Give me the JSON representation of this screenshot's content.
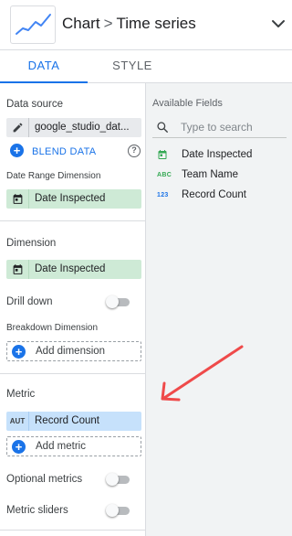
{
  "header": {
    "breadcrumb_parent": "Chart",
    "breadcrumb_separator": ">",
    "breadcrumb_current": "Time series"
  },
  "tabs": [
    {
      "label": "DATA",
      "active": true
    },
    {
      "label": "STYLE",
      "active": false
    }
  ],
  "data_panel": {
    "data_source_label": "Data source",
    "data_source_value": "google_studio_dat...",
    "blend_label": "BLEND DATA",
    "help_glyph": "?",
    "date_range_label": "Date Range Dimension",
    "date_range_value": "Date Inspected",
    "dimension_label": "Dimension",
    "dimension_value": "Date Inspected",
    "drill_down_label": "Drill down",
    "drill_down_enabled": false,
    "breakdown_label": "Breakdown Dimension",
    "add_dimension_label": "Add dimension",
    "metric_label": "Metric",
    "metric_type_badge": "AUT",
    "metric_value": "Record Count",
    "add_metric_label": "Add metric",
    "optional_metrics_label": "Optional metrics",
    "optional_metrics_enabled": false,
    "metric_sliders_label": "Metric sliders",
    "metric_sliders_enabled": false
  },
  "fields_panel": {
    "title": "Available Fields",
    "search_placeholder": "Type to search",
    "search_value": "",
    "fields": [
      {
        "type_icon": "calendar-icon",
        "name": "Date Inspected"
      },
      {
        "type_icon": "ABC",
        "name": "Team Name"
      },
      {
        "type_icon": "123",
        "name": "Record Count"
      }
    ]
  },
  "colors": {
    "accent": "#1a73e8",
    "dimension_chip": "#ceead6",
    "metric_chip": "#c6e1fb",
    "annotation_arrow": "#ef4a4a",
    "calendar_green": "#34a853"
  },
  "icons": {
    "header_thumb": "time-series-chart-icon",
    "header_expand": "chevron-down-icon",
    "source": "pencil-icon",
    "blend": "plus-circle-icon",
    "help": "help-icon",
    "date_chip": "calendar-icon",
    "search": "search-icon",
    "annotation": "red-arrow-icon"
  }
}
